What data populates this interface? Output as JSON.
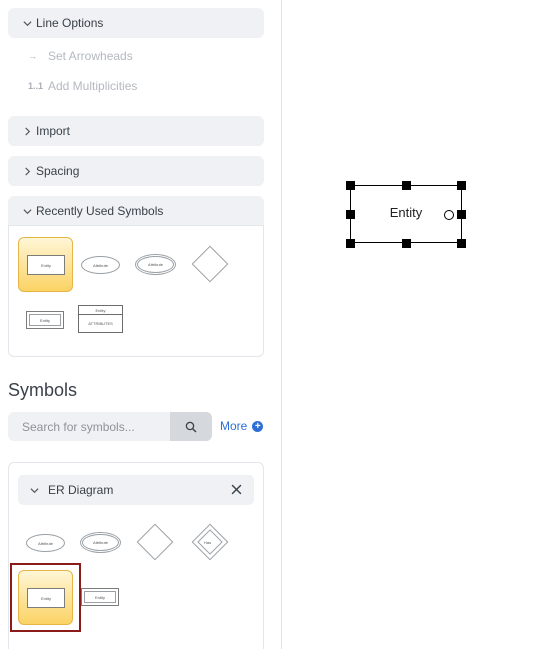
{
  "sidebar": {
    "line_options": {
      "label": "Line Options",
      "items": [
        {
          "icon": "arrow-right-icon",
          "glyph": "→",
          "label": "Set Arrowheads"
        },
        {
          "icon": "multiplicity-icon",
          "glyph": "1..1",
          "label": "Add Multiplicities"
        }
      ]
    },
    "import": {
      "label": "Import"
    },
    "spacing": {
      "label": "Spacing"
    },
    "recently_used": {
      "label": "Recently Used Symbols",
      "items": [
        {
          "name": "entity",
          "label": "Entity"
        },
        {
          "name": "attribute",
          "label": "Attribute"
        },
        {
          "name": "multivalued-attribute",
          "label": "Attribute"
        },
        {
          "name": "relationship",
          "label": ""
        },
        {
          "name": "weak-entity",
          "label": "Entity"
        },
        {
          "name": "entity-table",
          "label": "Entity",
          "body": "ATTRIBUTES"
        }
      ]
    },
    "symbols": {
      "title": "Symbols",
      "search_placeholder": "Search for symbols...",
      "more_label": "More",
      "er_diagram": {
        "label": "ER Diagram",
        "items": [
          {
            "name": "attribute",
            "label": "Attribute"
          },
          {
            "name": "multivalued-attribute",
            "label": "Attribute"
          },
          {
            "name": "relationship",
            "label": ""
          },
          {
            "name": "weak-relationship",
            "label": "Has"
          },
          {
            "name": "entity",
            "label": "Entity"
          },
          {
            "name": "weak-entity",
            "label": "Entity"
          }
        ]
      }
    }
  },
  "canvas": {
    "entity_label": "Entity"
  }
}
